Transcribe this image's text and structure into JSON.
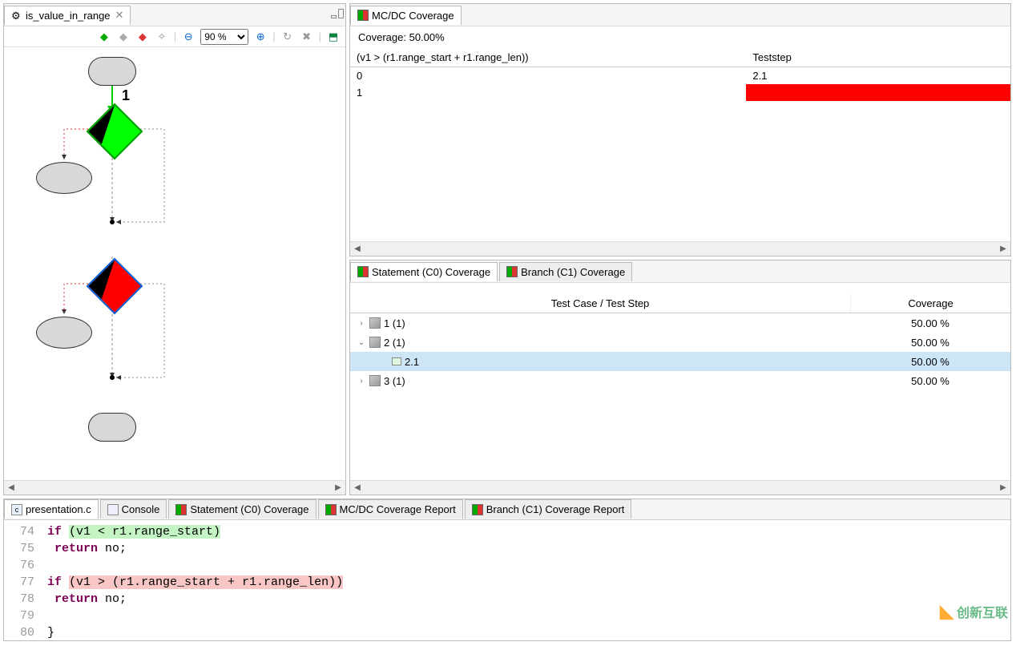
{
  "flow_pane": {
    "tab_title": "is_value_in_range",
    "zoom": "90 %",
    "edge_label": "1"
  },
  "mcdc_pane": {
    "title": "MC/DC Coverage",
    "coverage_label": "Coverage:  50.00%",
    "cond_header": "(v1 > (r1.range_start + r1.range_len))",
    "teststep_header": "Teststep",
    "rows": [
      {
        "cond": "0",
        "teststep": "2.1",
        "red": false
      },
      {
        "cond": "1",
        "teststep": "",
        "red": true
      }
    ]
  },
  "cov_tabs": {
    "tab1": "Statement (C0) Coverage",
    "tab2": "Branch (C1) Coverage"
  },
  "cov_tree": {
    "col1": "Test Case / Test Step",
    "col2": "Coverage",
    "rows": [
      {
        "indent": 0,
        "expanded": false,
        "icon": "cube",
        "label": "1 (1)",
        "cov": "50.00 %",
        "sel": false
      },
      {
        "indent": 0,
        "expanded": true,
        "icon": "cube",
        "label": "2 (1)",
        "cov": "50.00 %",
        "sel": false
      },
      {
        "indent": 1,
        "expanded": null,
        "icon": "sub",
        "label": "2.1",
        "cov": "50.00 %",
        "sel": true
      },
      {
        "indent": 0,
        "expanded": false,
        "icon": "cube",
        "label": "3 (1)",
        "cov": "50.00 %",
        "sel": false
      }
    ]
  },
  "bottom_tabs": {
    "tab1": "presentation.c",
    "tab2": "Console",
    "tab3": "Statement (C0) Coverage",
    "tab4": "MC/DC Coverage Report",
    "tab5": "Branch (C1) Coverage Report"
  },
  "code": {
    "lines": [
      {
        "n": "74",
        "kw": "if ",
        "hl": "green",
        "cond": "(v1 < r1.range_start)"
      },
      {
        "n": "75",
        "kw": "    return",
        "plain": " no;"
      },
      {
        "n": "76",
        "plain": ""
      },
      {
        "n": "77",
        "kw": "if ",
        "hl": "red",
        "cond": "(v1 > (r1.range_start + r1.range_len))"
      },
      {
        "n": "78",
        "kw": "    return",
        "plain": " no;"
      },
      {
        "n": "79",
        "plain": ""
      },
      {
        "n": "80",
        "plain": "}"
      }
    ]
  },
  "watermark": "创新互联"
}
